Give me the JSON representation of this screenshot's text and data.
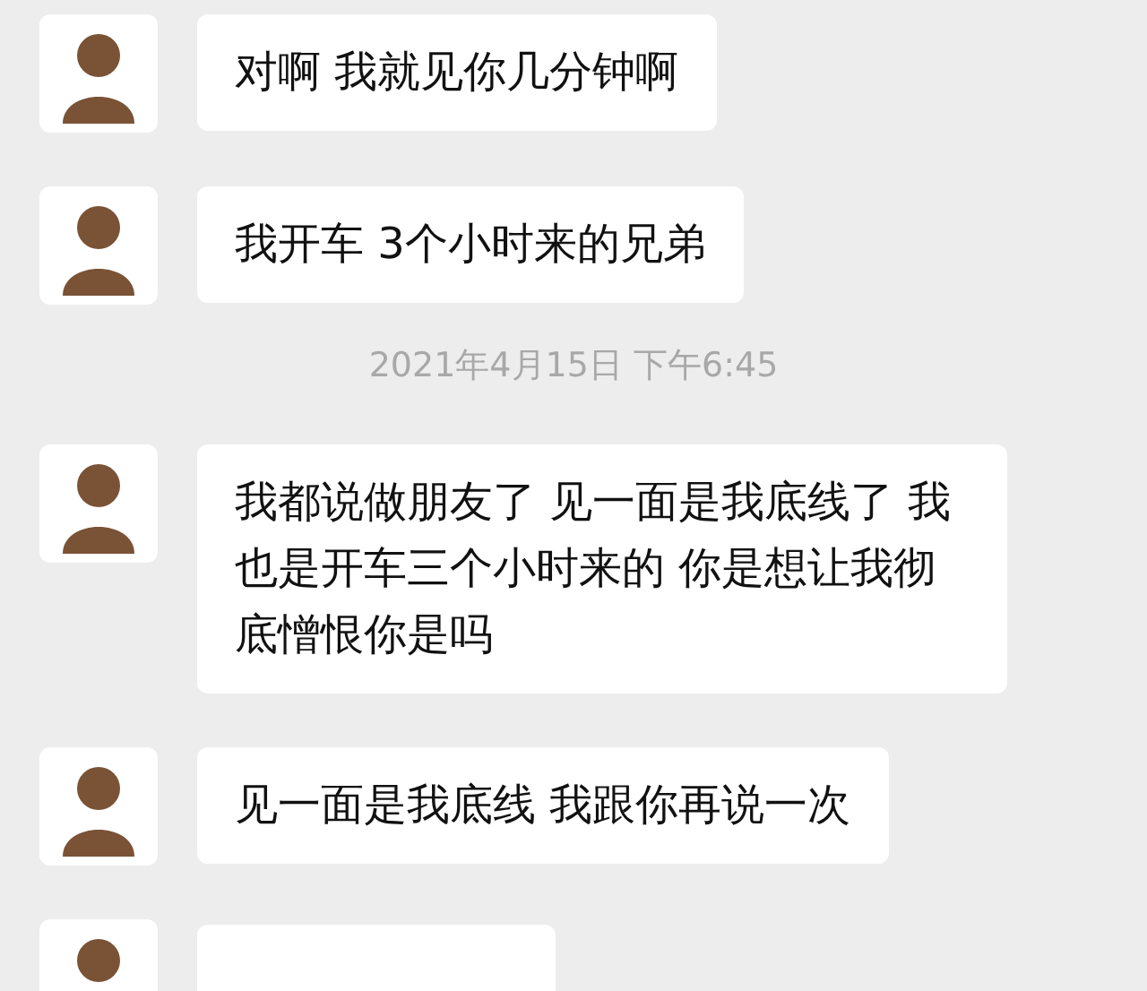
{
  "messages": [
    {
      "kind": "text",
      "text": "对啊 我就见你几分钟啊"
    },
    {
      "kind": "text",
      "text": "我开车 3个小时来的兄弟"
    },
    {
      "kind": "time",
      "text": "2021年4月15日 下午6:45"
    },
    {
      "kind": "text",
      "text": "我都说做朋友了 见一面是我底线了 我也是开车三个小时来的 你是想让我彻底憎恨你是吗"
    },
    {
      "kind": "text",
      "text": "见一面是我底线 我跟你再说一次"
    },
    {
      "kind": "partial"
    }
  ]
}
